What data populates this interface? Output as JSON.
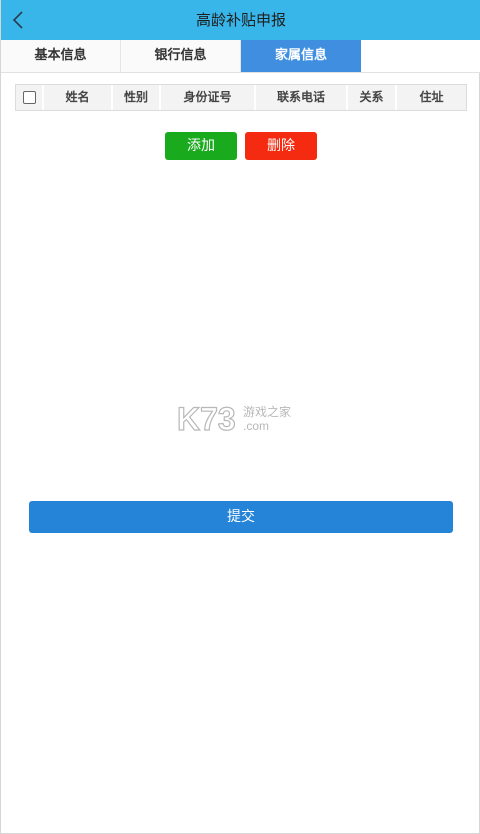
{
  "header": {
    "title": "高龄补贴申报",
    "back_icon": "chevron-left-icon"
  },
  "tabs": [
    {
      "label": "基本信息",
      "active": false
    },
    {
      "label": "银行信息",
      "active": false
    },
    {
      "label": "家属信息",
      "active": true
    }
  ],
  "table": {
    "columns": [
      "姓名",
      "性别",
      "身份证号",
      "联系电话",
      "关系",
      "住址"
    ],
    "rows": []
  },
  "actions": {
    "add_label": "添加",
    "delete_label": "删除"
  },
  "submit_label": "提交",
  "watermark": {
    "brand": "K73",
    "chinese": "游戏之家",
    "domain": ".com"
  },
  "colors": {
    "header_bg": "#38b6ea",
    "active_tab_bg": "#3f8ee0",
    "add_button": "#1aaa1d",
    "delete_button": "#f42b10",
    "submit_button": "#2583d8"
  }
}
